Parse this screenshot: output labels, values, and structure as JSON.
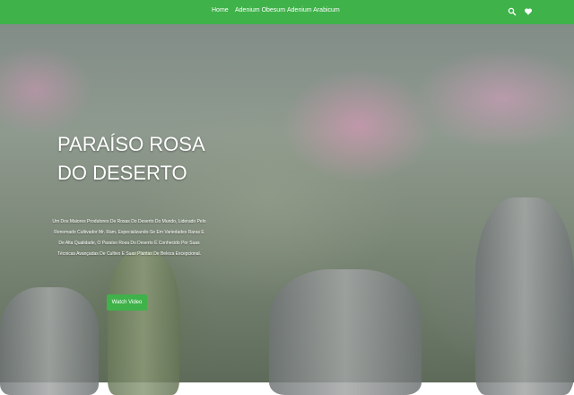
{
  "nav": {
    "links": [
      {
        "label": "Home"
      },
      {
        "label": "Adenium Obesum"
      },
      {
        "label": "Adenium Arabicum"
      }
    ],
    "icons": [
      "search-icon",
      "heart-icon"
    ],
    "background_color": "#3fb24a"
  },
  "hero": {
    "title_line1": "PARAÍSO ROSA",
    "title_line2": "DO DESERTO",
    "description": "Um Dos Maiores Produtores De Rosas Do Deserto Do Mundo, Liderado Pelo Renomado Cultivador Mr. Ram. Especializando-Se Em Variedades Raras E De Alta Qualidade, O Paraíso Rosa Do Deserto É Conhecido Por Suas Técnicas Avançadas De Cultivo E Suas Plantas De Beleza Excepcional.",
    "cta_label": "Watch Video",
    "cta_color": "#3fb24a"
  }
}
